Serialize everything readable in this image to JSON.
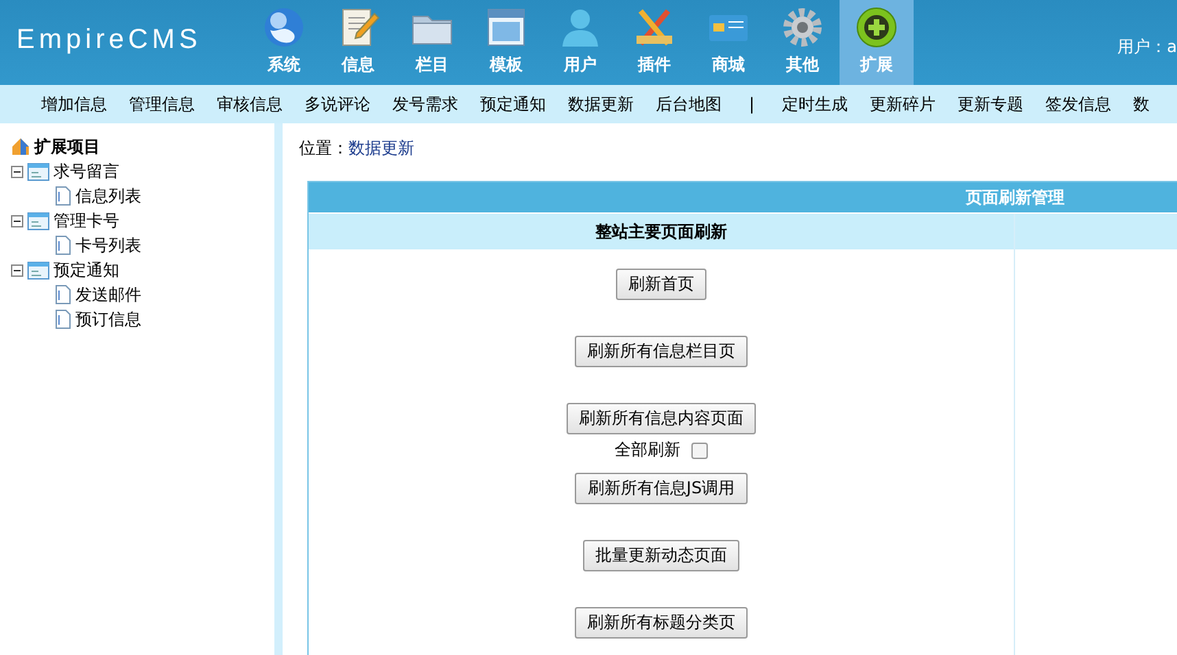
{
  "header": {
    "logo": "EmpireCMS",
    "nav": [
      {
        "label": "系统",
        "selected": false
      },
      {
        "label": "信息",
        "selected": false
      },
      {
        "label": "栏目",
        "selected": false
      },
      {
        "label": "模板",
        "selected": false
      },
      {
        "label": "用户",
        "selected": false
      },
      {
        "label": "插件",
        "selected": false
      },
      {
        "label": "商城",
        "selected": false
      },
      {
        "label": "其他",
        "selected": false
      },
      {
        "label": "扩展",
        "selected": true
      }
    ],
    "user_label": "用户：a"
  },
  "submenu": [
    {
      "label": "增加信息"
    },
    {
      "label": "管理信息"
    },
    {
      "label": "审核信息"
    },
    {
      "label": "多说评论"
    },
    {
      "label": "发号需求"
    },
    {
      "label": "预定通知"
    },
    {
      "label": "数据更新"
    },
    {
      "label": "后台地图"
    },
    {
      "label": "|",
      "kind": "separator"
    },
    {
      "label": "定时生成"
    },
    {
      "label": "更新碎片"
    },
    {
      "label": "更新专题"
    },
    {
      "label": "签发信息"
    },
    {
      "label": "数"
    }
  ],
  "sidebar": {
    "title": "扩展项目",
    "items": [
      {
        "label": "求号留言",
        "expanded": true,
        "children": [
          {
            "label": "信息列表"
          }
        ]
      },
      {
        "label": "管理卡号",
        "expanded": true,
        "children": [
          {
            "label": "卡号列表"
          }
        ]
      },
      {
        "label": "预定通知",
        "expanded": true,
        "children": [
          {
            "label": "发送邮件"
          },
          {
            "label": "预订信息"
          }
        ]
      }
    ]
  },
  "breadcrumb": {
    "label": "位置：",
    "link": "数据更新"
  },
  "panel": {
    "title": "页面刷新管理",
    "section": "整站主要页面刷新",
    "groups": [
      [
        {
          "kind": "button",
          "label": "刷新首页"
        }
      ],
      [
        {
          "kind": "button",
          "label": "刷新所有信息栏目页"
        }
      ],
      [
        {
          "kind": "button",
          "label": "刷新所有信息内容页面"
        },
        {
          "kind": "checkbox",
          "label": "全部刷新",
          "checked": false
        }
      ],
      [
        {
          "kind": "button",
          "label": "刷新所有信息JS调用"
        }
      ],
      [
        {
          "kind": "button",
          "label": "批量更新动态页面"
        }
      ],
      [
        {
          "kind": "button",
          "label": "刷新所有标题分类页"
        }
      ]
    ]
  }
}
